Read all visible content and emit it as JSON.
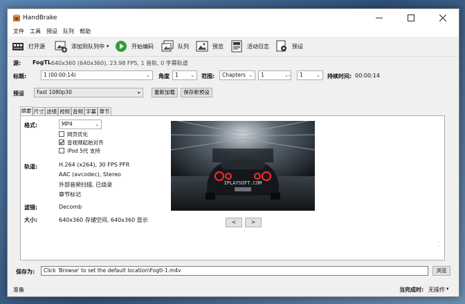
{
  "window": {
    "title": "HandBrake",
    "controls": {
      "minimize": "minimize-icon",
      "maximize": "maximize-icon",
      "close": "close-icon"
    }
  },
  "menu": [
    "文件",
    "工具",
    "预设",
    "队列",
    "帮助"
  ],
  "toolbar": {
    "open_source": "打开源",
    "add_to_queue": "添加到队列中",
    "start_encode": "开始编码",
    "queue": "队列",
    "preview": "预览",
    "activity_log": "活动日志",
    "presets": "预设"
  },
  "source": {
    "label": "源:",
    "name": "FogTL",
    "info": "640x360 (640x360), 23.98 FPS, 1 音轨, 0 字幕轨道"
  },
  "title_row": {
    "title_label": "标题:",
    "title_value": "1 (00:00:14)",
    "angle_label": "角度",
    "angle_value": "1",
    "range_label": "范围:",
    "range_type": "Chapters",
    "range_start": "1",
    "range_dash": "-",
    "range_end": "1",
    "duration_label": "持续时间:",
    "duration_value": "00:00:14"
  },
  "preset_row": {
    "label": "预设",
    "value": "Fast 1080p30",
    "reload": "重新加载",
    "save_new": "保存新预设"
  },
  "tabs": [
    "摘要",
    "尺寸",
    "滤镜",
    "视频",
    "音频",
    "字幕",
    "章节"
  ],
  "summary": {
    "format_label": "格式:",
    "format_value": "MP4",
    "web_optimized": "网页优化",
    "align_av": "音视频起始对齐",
    "ipod": "iPod 5代 支持",
    "align_av_checked": true,
    "tracks_label": "轨道:",
    "tracks": [
      "H.264 (x264), 30 FPS PFR",
      "AAC (avcodec), Stereo",
      "外部音频扫描, 已烧录",
      "章节标记"
    ],
    "filters_label": "滤镜:",
    "filters_value": "Decomb",
    "size_label": "大小:",
    "size_value": "640x360 存储空间, 640x360 显示",
    "preview_watermark": "IPLAYSOFT.COM",
    "prev_btn": "<",
    "next_btn": ">"
  },
  "save_as": {
    "label": "保存为:",
    "value": "Click 'Browse' to set the default location\\FogtI-1.m4v",
    "browse": "浏览"
  },
  "status": {
    "ready": "准备",
    "when_done_label": "当完成时:",
    "when_done_value": "无操作"
  }
}
